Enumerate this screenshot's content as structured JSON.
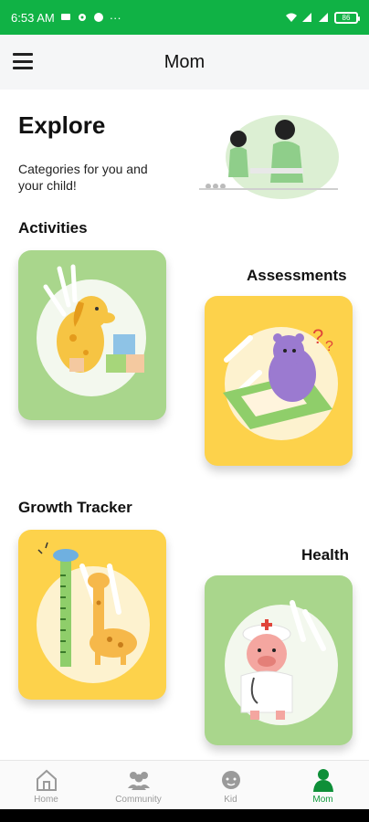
{
  "statusbar": {
    "time": "6:53 AM",
    "battery": "86"
  },
  "appbar": {
    "title": "Mom"
  },
  "explore": {
    "title": "Explore",
    "subtitle": "Categories for you and your child!"
  },
  "sections": {
    "activities": "Activities",
    "assessments": "Assessments",
    "growth_tracker": "Growth Tracker",
    "health": "Health"
  },
  "bottom_nav": {
    "home": "Home",
    "community": "Community",
    "kid": "Kid",
    "mom": "Mom",
    "active": "Mom"
  },
  "colors": {
    "primary_green": "#10b245",
    "card_green": "#a9d68c",
    "card_yellow": "#fdd24b"
  },
  "icons": [
    "menu-icon",
    "home-icon",
    "community-icon",
    "kid-icon",
    "mom-icon"
  ]
}
